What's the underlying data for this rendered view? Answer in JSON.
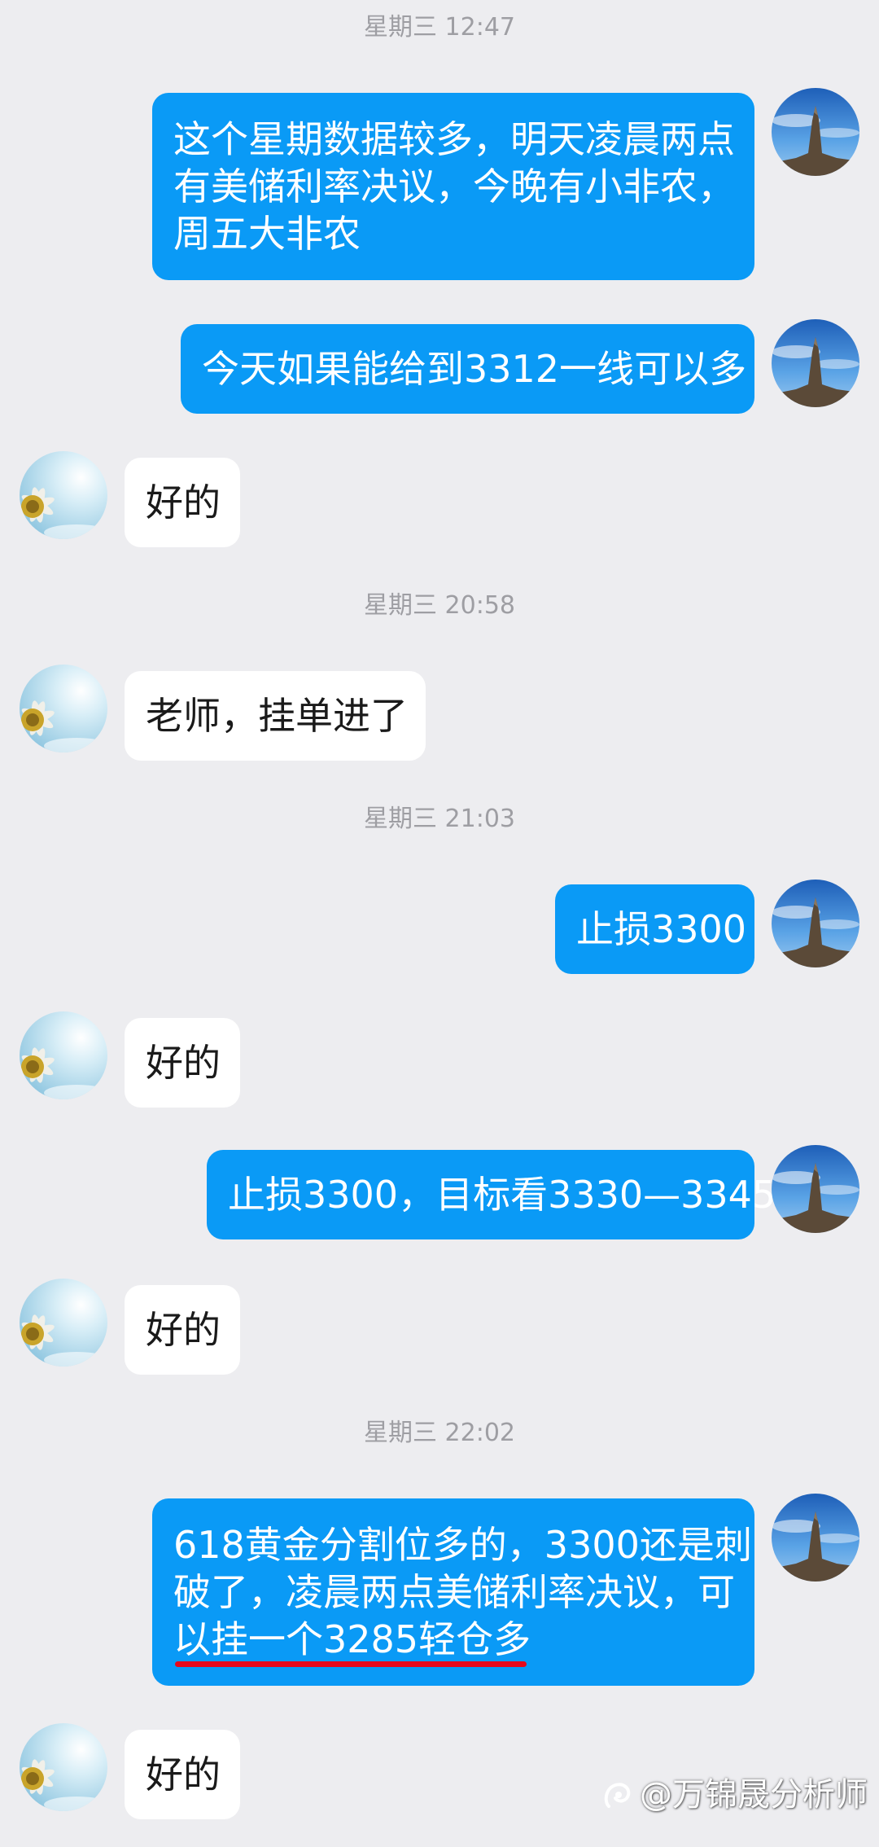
{
  "colors": {
    "background": "#ededf0",
    "outgoing_bubble": "#0a9af6",
    "incoming_bubble": "#ffffff",
    "timestamp": "#9e9ea3",
    "highlight_underline": "#e8071a"
  },
  "messages": [
    {
      "type": "timestamp",
      "text": "星期三 12:47"
    },
    {
      "type": "outgoing",
      "avatar": "mountain-peak-avatar",
      "lines": [
        "这个星期数据较多，明天凌晨两点",
        "有美储利率决议，今晚有小非农，",
        "周五大非农"
      ]
    },
    {
      "type": "outgoing",
      "avatar": "mountain-peak-avatar",
      "lines": [
        "今天如果能给到3312一线可以多"
      ]
    },
    {
      "type": "incoming",
      "avatar": "sunflower-avatar",
      "lines": [
        "好的"
      ]
    },
    {
      "type": "timestamp",
      "text": "星期三 20:58"
    },
    {
      "type": "incoming",
      "avatar": "sunflower-avatar",
      "lines": [
        "老师，挂单进了"
      ]
    },
    {
      "type": "timestamp",
      "text": "星期三 21:03"
    },
    {
      "type": "outgoing",
      "avatar": "mountain-peak-avatar",
      "lines": [
        "止损3300"
      ]
    },
    {
      "type": "incoming",
      "avatar": "sunflower-avatar",
      "lines": [
        "好的"
      ]
    },
    {
      "type": "outgoing",
      "avatar": "mountain-peak-avatar",
      "lines": [
        "止损3300，目标看3330—3345"
      ]
    },
    {
      "type": "incoming",
      "avatar": "sunflower-avatar",
      "lines": [
        "好的"
      ]
    },
    {
      "type": "timestamp",
      "text": "星期三 22:02"
    },
    {
      "type": "outgoing",
      "avatar": "mountain-peak-avatar",
      "lines": [
        "618黄金分割位多的，3300还是刺",
        "破了，凌晨两点美储利率决议，可",
        "以挂一个3285轻仓多"
      ]
    },
    {
      "type": "incoming",
      "avatar": "sunflower-avatar",
      "lines": [
        "好的"
      ]
    }
  ],
  "watermark": {
    "icon": "zhihu-style-logo-icon",
    "text": "@万锦晟分析师"
  }
}
